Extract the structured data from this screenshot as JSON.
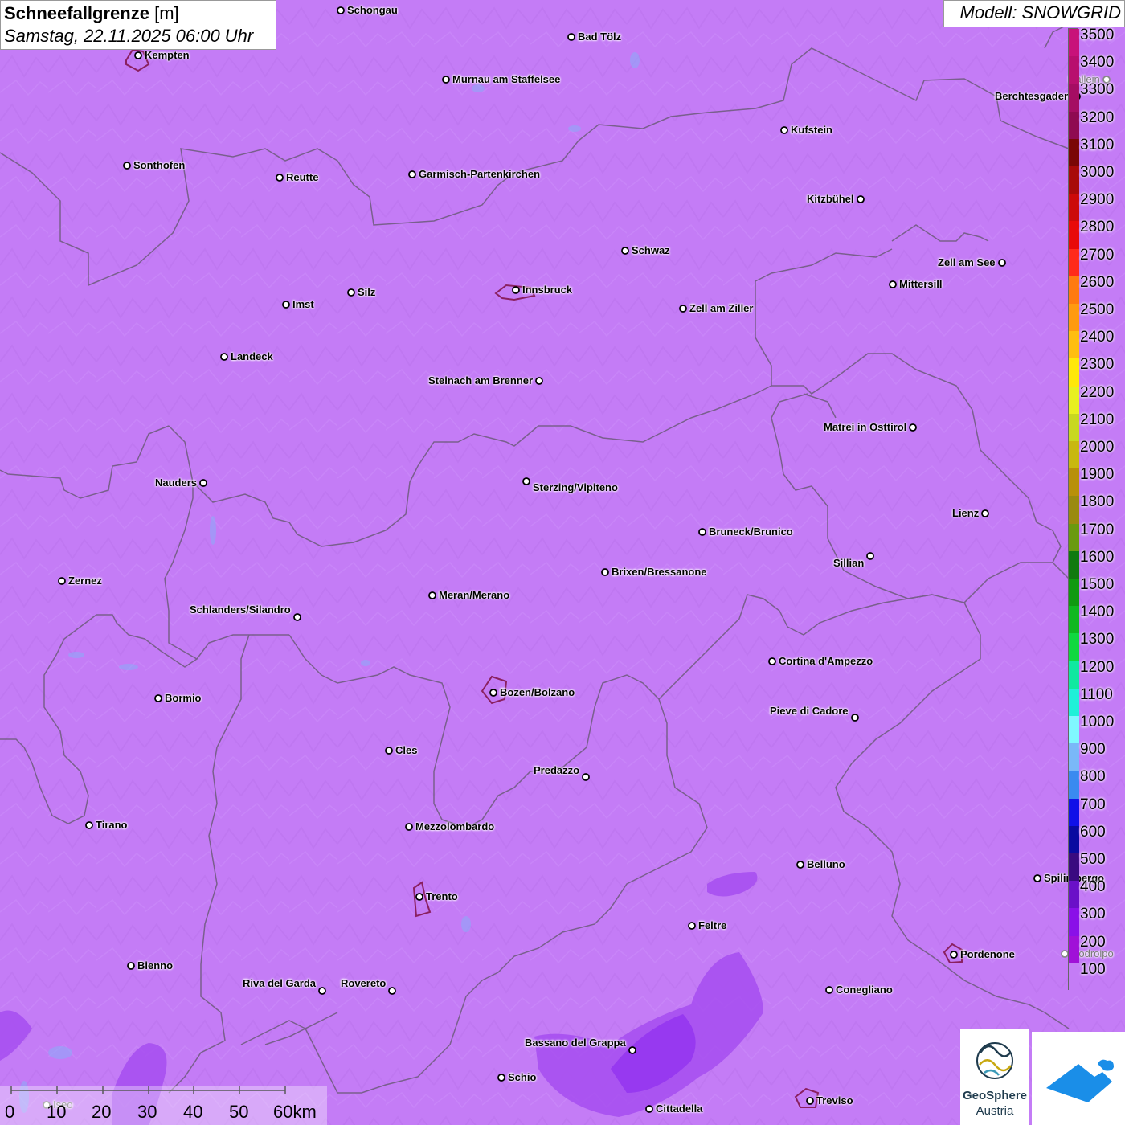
{
  "title": {
    "parameter": "Schneefallgrenze",
    "unit": "[m]",
    "datetime": "Samstag, 22.11.2025 06:00 Uhr"
  },
  "model": "Modell: SNOWGRID",
  "legend": [
    {
      "label": "3500",
      "color": "#c8127a"
    },
    {
      "label": "3400",
      "color": "#b80f6e"
    },
    {
      "label": "3300",
      "color": "#a50d63"
    },
    {
      "label": "3200",
      "color": "#8f0a52"
    },
    {
      "label": "3100",
      "color": "#7a0606"
    },
    {
      "label": "3000",
      "color": "#a80a0a"
    },
    {
      "label": "2900",
      "color": "#cc0a0a"
    },
    {
      "label": "2800",
      "color": "#e80a0a"
    },
    {
      "label": "2700",
      "color": "#ff2a1a"
    },
    {
      "label": "2600",
      "color": "#ff7a10"
    },
    {
      "label": "2500",
      "color": "#ff9a10"
    },
    {
      "label": "2400",
      "color": "#ffbe10"
    },
    {
      "label": "2300",
      "color": "#ffe80a"
    },
    {
      "label": "2200",
      "color": "#e8f020"
    },
    {
      "label": "2100",
      "color": "#c8d820"
    },
    {
      "label": "2000",
      "color": "#c8b810"
    },
    {
      "label": "1900",
      "color": "#b8900a"
    },
    {
      "label": "1800",
      "color": "#9a8a10"
    },
    {
      "label": "1700",
      "color": "#6a9a10"
    },
    {
      "label": "1600",
      "color": "#107a10"
    },
    {
      "label": "1500",
      "color": "#109a10"
    },
    {
      "label": "1400",
      "color": "#10b820"
    },
    {
      "label": "1300",
      "color": "#10d840"
    },
    {
      "label": "1200",
      "color": "#10e8a0"
    },
    {
      "label": "1100",
      "color": "#20f0d8"
    },
    {
      "label": "1000",
      "color": "#80f8ff"
    },
    {
      "label": "900",
      "color": "#7ab8f8"
    },
    {
      "label": "800",
      "color": "#3a8af0"
    },
    {
      "label": "700",
      "color": "#1010e8"
    },
    {
      "label": "600",
      "color": "#0a0aa0"
    },
    {
      "label": "500",
      "color": "#3a0a80"
    },
    {
      "label": "400",
      "color": "#6a10c8"
    },
    {
      "label": "300",
      "color": "#8a10e8"
    },
    {
      "label": "200",
      "color": "#a010d8"
    },
    {
      "label": "100",
      "color": "#c47cf6"
    }
  ],
  "cities": [
    {
      "name": "Schongau"
    },
    {
      "name": "Bad Tölz"
    },
    {
      "name": "Kempten"
    },
    {
      "name": "Murnau am Staffelsee"
    },
    {
      "name": "Hallein"
    },
    {
      "name": "Berchtesgaden"
    },
    {
      "name": "Kufstein"
    },
    {
      "name": "Sonthofen"
    },
    {
      "name": "Reutte"
    },
    {
      "name": "Garmisch-Partenkirchen"
    },
    {
      "name": "Kitzbühel"
    },
    {
      "name": "Schwaz"
    },
    {
      "name": "Zell am See"
    },
    {
      "name": "Innsbruck"
    },
    {
      "name": "Mittersill"
    },
    {
      "name": "Imst"
    },
    {
      "name": "Silz"
    },
    {
      "name": "Zell am Ziller"
    },
    {
      "name": "Landeck"
    },
    {
      "name": "Steinach am Brenner"
    },
    {
      "name": "Matrei in Osttirol"
    },
    {
      "name": "Nauders"
    },
    {
      "name": "Sterzing/Vipiteno"
    },
    {
      "name": "Lienz"
    },
    {
      "name": "Bruneck/Brunico"
    },
    {
      "name": "Sillian"
    },
    {
      "name": "Brixen/Bressanone"
    },
    {
      "name": "Zernez"
    },
    {
      "name": "Meran/Merano"
    },
    {
      "name": "Schlanders/Silandro"
    },
    {
      "name": "Cortina d'Ampezzo"
    },
    {
      "name": "Bozen/Bolzano"
    },
    {
      "name": "Bormio"
    },
    {
      "name": "Pieve di Cadore"
    },
    {
      "name": "Cles"
    },
    {
      "name": "Predazzo"
    },
    {
      "name": "Tirano"
    },
    {
      "name": "Mezzolombardo"
    },
    {
      "name": "Belluno"
    },
    {
      "name": "Spilimbergo"
    },
    {
      "name": "Trento"
    },
    {
      "name": "Feltre"
    },
    {
      "name": "Pordenone"
    },
    {
      "name": "Codroipo"
    },
    {
      "name": "Bienno"
    },
    {
      "name": "Riva del Garda"
    },
    {
      "name": "Rovereto"
    },
    {
      "name": "Conegliano"
    },
    {
      "name": "Bassano del Grappa"
    },
    {
      "name": "Schio"
    },
    {
      "name": "Treviso"
    },
    {
      "name": "Cittadella"
    },
    {
      "name": "Iseo"
    }
  ],
  "scale": {
    "ticks": [
      "0",
      "10",
      "20",
      "30",
      "40",
      "50",
      "60km"
    ]
  },
  "logo": {
    "line1": "GeoSphere",
    "line2": "Austria"
  }
}
